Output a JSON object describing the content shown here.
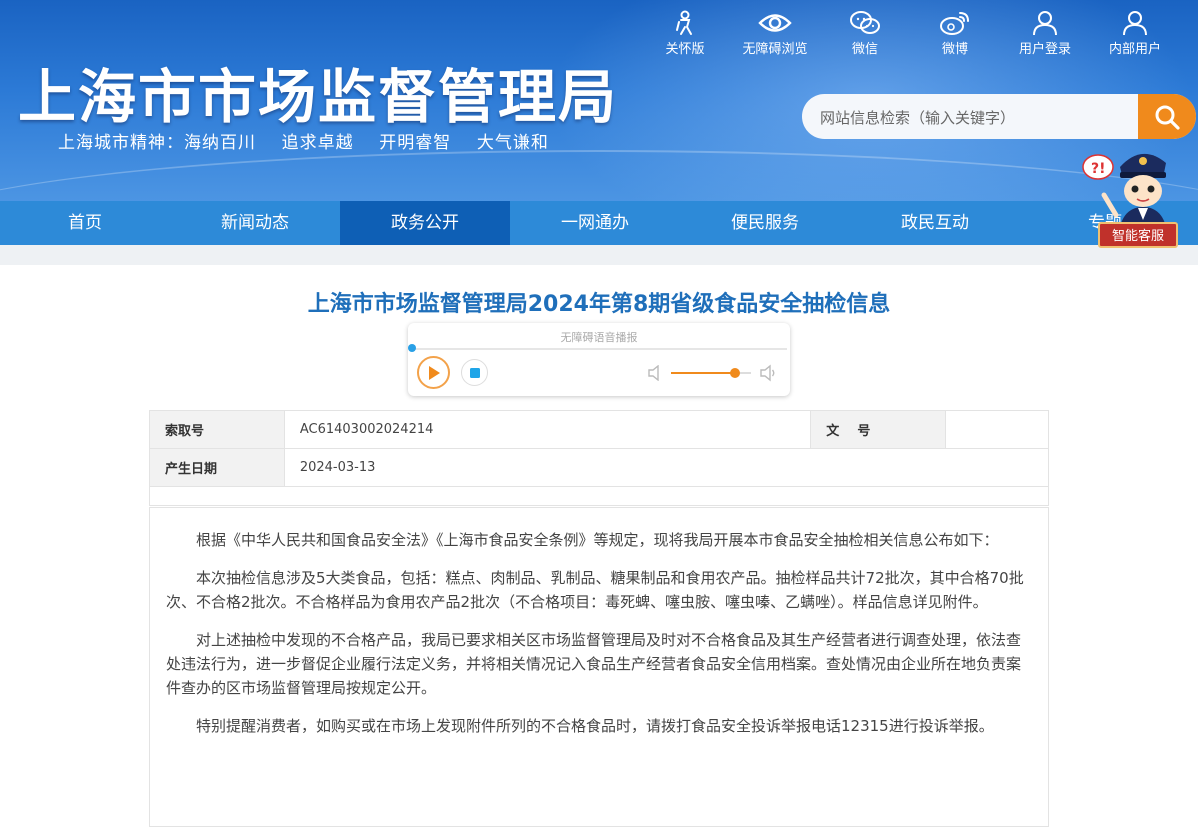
{
  "header": {
    "title": "上海市市场监督管理局",
    "slogan": "上海城市精神：海纳百川    追求卓越    开明睿智    大气谦和",
    "top_links": [
      {
        "label": "关怀版",
        "icon": "elderly-care-icon"
      },
      {
        "label": "无障碍浏览",
        "icon": "eye-icon"
      },
      {
        "label": "微信",
        "icon": "wechat-icon"
      },
      {
        "label": "微博",
        "icon": "weibo-icon"
      },
      {
        "label": "用户登录",
        "icon": "user-icon"
      },
      {
        "label": "内部用户",
        "icon": "user-icon"
      }
    ],
    "search": {
      "placeholder": "网站信息检索（输入关键字）",
      "button_icon": "search-icon"
    }
  },
  "nav": {
    "items": [
      "首页",
      "新闻动态",
      "政务公开",
      "一网通办",
      "便民服务",
      "政民互动",
      "专题"
    ],
    "active": "政务公开"
  },
  "assistant": {
    "label": "智能客服",
    "icon": "police-mascot-icon"
  },
  "article": {
    "title": "上海市市场监督管理局2024年第8期省级食品安全抽检信息",
    "player": {
      "label": "无障碍语音播报",
      "volume": 0.8
    },
    "meta": {
      "index_label": "索取号",
      "index_value": "AC61403002024214",
      "doc_label": "文    号",
      "doc_value": "",
      "date_label": "产生日期",
      "date_value": "2024-03-13"
    },
    "paragraphs": [
      "根据《中华人民共和国食品安全法》《上海市食品安全条例》等规定，现将我局开展本市食品安全抽检相关信息公布如下：",
      "本次抽检信息涉及5大类食品，包括：糕点、肉制品、乳制品、糖果制品和食用农产品。抽检样品共计72批次，其中合格70批次、不合格2批次。不合格样品为食用农产品2批次（不合格项目：毒死蜱、噻虫胺、噻虫嗪、乙螨唑）。样品信息详见附件。",
      "对上述抽检中发现的不合格产品，我局已要求相关区市场监督管理局及时对不合格食品及其生产经营者进行调查处理，依法查处违法行为，进一步督促企业履行法定义务，并将相关情况记入食品生产经营者食品安全信用档案。查处情况由企业所在地负责案件查办的区市场监督管理局按规定公开。",
      "特别提醒消费者，如购买或在市场上发现附件所列的不合格食品时，请拨打食品安全投诉举报电话12315进行投诉举报。"
    ]
  },
  "colors": {
    "header_blue": "#1a63c2",
    "nav_blue": "#2d8ad8",
    "nav_active": "#0e5fb5",
    "accent_orange": "#f08a1c",
    "title_blue": "#1f6fba"
  }
}
